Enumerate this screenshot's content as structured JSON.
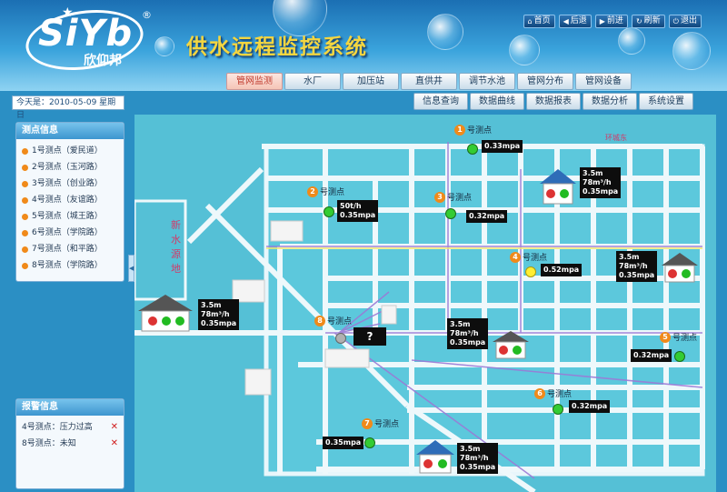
{
  "header": {
    "logo_text": "SiYb",
    "logo_cn": "欣仰邦",
    "title": "供水远程监控系统",
    "nav": [
      {
        "icon": "home-icon",
        "label": "首页"
      },
      {
        "icon": "back-icon",
        "label": "后退"
      },
      {
        "icon": "forward-icon",
        "label": "前进"
      },
      {
        "icon": "refresh-icon",
        "label": "刷新"
      },
      {
        "icon": "power-icon",
        "label": "退出"
      }
    ]
  },
  "tabs_main": [
    "管网监测",
    "水厂",
    "加压站",
    "直供井",
    "调节水池",
    "管网分布",
    "管网设备"
  ],
  "tabs_sub": [
    "信息查询",
    "数据曲线",
    "数据报表",
    "数据分析",
    "系统设置"
  ],
  "date": "今天是：2010-05-09 星期日",
  "sidebar": {
    "points_title": "测点信息",
    "points": [
      "1号测点（爱民道）",
      "2号测点（玉河路）",
      "3号测点（创业路）",
      "4号测点（友谊路）",
      "5号测点（城王路）",
      "6号测点（学院路）",
      "7号测点（和平路）",
      "8号测点（学院路）"
    ],
    "alarm_title": "报警信息",
    "alarms": [
      {
        "text": "4号测点：压力过高"
      },
      {
        "text": "8号测点：未知"
      }
    ]
  },
  "map": {
    "pool_label": "新水源地",
    "points": [
      {
        "num": "1",
        "label": "号测点",
        "reading": "0.33mpa",
        "status": "normal"
      },
      {
        "num": "2",
        "label": "号测点",
        "reading": "50t/h\n0.35mpa",
        "status": "normal"
      },
      {
        "num": "3",
        "label": "号测点",
        "reading": "0.32mpa",
        "status": "normal"
      },
      {
        "num": "4",
        "label": "号测点",
        "reading": "0.52mpa",
        "status": "warning"
      },
      {
        "num": "5",
        "label": "号测点",
        "reading": "0.32mpa",
        "status": "normal"
      },
      {
        "num": "6",
        "label": "号测点",
        "reading": "0.32mpa",
        "status": "normal"
      },
      {
        "num": "7",
        "label": "号测点",
        "reading": "0.35mpa",
        "status": "normal"
      },
      {
        "num": "8",
        "label": "号测点",
        "reading": "?",
        "status": "unknown"
      }
    ],
    "stations": [
      {
        "lines": [
          "3.5m",
          "78m³/h",
          "0.35mpa"
        ]
      },
      {
        "lines": [
          "3.5m",
          "78m³/h",
          "0.35mpa"
        ]
      },
      {
        "lines": [
          "3.5m",
          "78m³/h",
          "0.35mpa"
        ]
      },
      {
        "lines": [
          "3.5m",
          "78m³/h",
          "0.35mpa"
        ]
      },
      {
        "lines": [
          "3.5m",
          "78m³/h",
          "0.35mpa"
        ]
      }
    ],
    "corner_label": "环城东"
  },
  "colors": {
    "normal": "#33cc33",
    "warning": "#ffee33",
    "unknown": "#b0b0b0",
    "accent": "#f08a1a"
  }
}
